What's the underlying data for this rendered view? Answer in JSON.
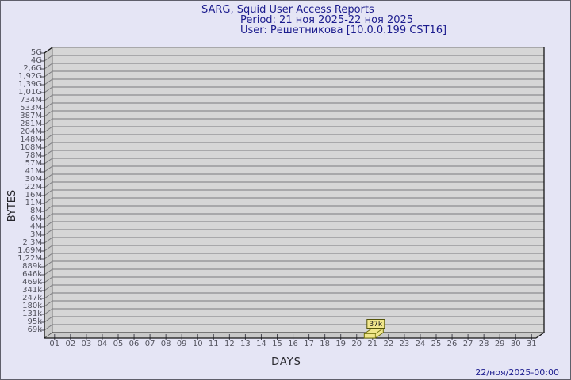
{
  "header": {
    "title": "SARG, Squid User Access Reports",
    "period": "Period: 21 ноя 2025-22 ноя 2025",
    "user": "User: Решетникова [10.0.0.199 CST16]"
  },
  "footer": {
    "generated": "22/ноя/2025-00:00"
  },
  "colors": {
    "page_bg": "#e5e5f5",
    "title_navy": "#1c1c8e",
    "plot_fill": "#d6d6d6",
    "wall_fill": "#c9c9c9",
    "gridline": "#79797d",
    "axis_dark": "#161616",
    "tick_grey": "#45454f",
    "bar_fill": "#f0e68c",
    "bar_border": "#6e6e08"
  },
  "chart_data": {
    "type": "bar",
    "title": "SARG, Squid User Access Reports",
    "subtitle": "Period: 21 ноя 2025-22 ноя 2025 — User: Решетникова [10.0.0.199 CST16]",
    "xlabel": "DAYS",
    "ylabel": "BYTES",
    "grid": true,
    "legend_position": "none",
    "y_scale": "custom-log-like",
    "ylim_bytes": [
      0,
      5368709120
    ],
    "y_ticks": [
      "5G",
      "4G",
      "2,6G",
      "1,92G",
      "1,39G",
      "1,01G",
      "734M",
      "533M",
      "387M",
      "281M",
      "204M",
      "148M",
      "108M",
      "78M",
      "57M",
      "41M",
      "30M",
      "22M",
      "16M",
      "11M",
      "8M",
      "6M",
      "4M",
      "3M",
      "2,3M",
      "1,69M",
      "1,22M",
      "889k",
      "646k",
      "469k",
      "341k",
      "247k",
      "180k",
      "131k",
      "95k",
      "69k"
    ],
    "categories": [
      "01",
      "02",
      "03",
      "04",
      "05",
      "06",
      "07",
      "08",
      "09",
      "10",
      "11",
      "12",
      "13",
      "14",
      "15",
      "16",
      "17",
      "18",
      "19",
      "20",
      "21",
      "22",
      "23",
      "24",
      "25",
      "26",
      "27",
      "28",
      "29",
      "30",
      "31"
    ],
    "series": [
      {
        "name": "bytes",
        "values": [
          0,
          0,
          0,
          0,
          0,
          0,
          0,
          0,
          0,
          0,
          0,
          0,
          0,
          0,
          0,
          0,
          0,
          0,
          0,
          0,
          37000,
          0,
          0,
          0,
          0,
          0,
          0,
          0,
          0,
          0,
          0
        ]
      }
    ],
    "bars": [
      {
        "day": 21,
        "label": "37k",
        "value_bytes": 37000
      }
    ]
  }
}
